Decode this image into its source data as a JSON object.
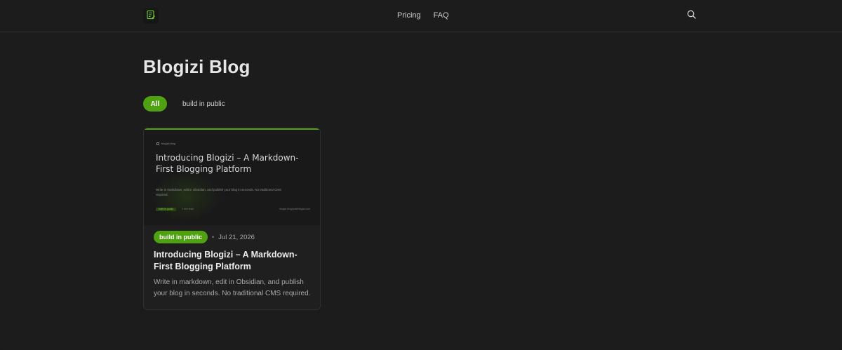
{
  "header": {
    "logo_icon": "notepad-edit-icon",
    "nav": [
      {
        "label": "Pricing"
      },
      {
        "label": "FAQ"
      }
    ],
    "search_icon": "search-icon"
  },
  "main": {
    "title": "Blogizi Blog",
    "filters": [
      {
        "label": "All",
        "active": true
      },
      {
        "label": "build in public",
        "active": false
      }
    ],
    "posts": [
      {
        "thumbnail": {
          "site": "blogizi.blog",
          "title": "Introducing Blogizi – A Markdown-First Blogging Platform",
          "description": "Write in markdown, edit in Obsidian, and publish your blog in seconds. No traditional CMS required.",
          "tag": "build in public",
          "read_time": "1 min read",
          "url": "blogizi.blog/post/blogizi.com"
        },
        "tag": "build in public",
        "separator": "•",
        "date": "Jul 21, 2026",
        "title": "Introducing Blogizi – A Markdown-First Blogging Platform",
        "description": "Write in markdown, edit in Obsidian, and publish your blog in seconds. No traditional CMS required."
      }
    ]
  },
  "colors": {
    "background": "#1c1c1c",
    "accent": "#4ea10f",
    "text": "#e8e8e8",
    "muted": "#a8a8a8"
  }
}
